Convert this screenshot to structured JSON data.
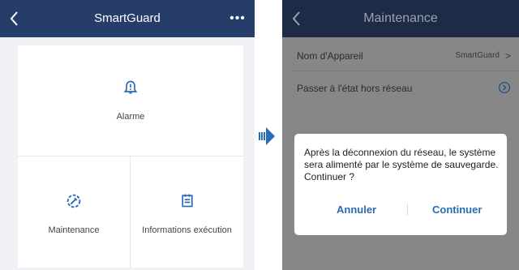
{
  "colors": {
    "header": "#263c69",
    "accent": "#2a6bb7",
    "overlay": "#878787"
  },
  "left_screen": {
    "header": {
      "back_icon": "chevron-left-icon",
      "title": "SmartGuard",
      "more_icon": "more-dots-icon"
    },
    "tiles": [
      {
        "icon": "alarm-bell-icon",
        "label": "Alarme"
      },
      {
        "icon": "wrench-gear-icon",
        "label": "Maintenance"
      },
      {
        "icon": "clipboard-icon",
        "label": "Informations exécution"
      }
    ]
  },
  "transition_icon": "arrow-right-icon",
  "right_screen": {
    "header": {
      "back_icon": "chevron-left-icon",
      "title": "Maintenance"
    },
    "rows": [
      {
        "label": "Nom d'Appareil",
        "value": "SmartGuard",
        "chevron": ">"
      },
      {
        "label": "Passer à l'état hors réseau",
        "icon": "circle-arrow-icon"
      }
    ],
    "dialog": {
      "message": "Après la déconnexion du réseau, le système sera alimenté par le système de sauvegarde. Continuer ?",
      "cancel_label": "Annuler",
      "confirm_label": "Continuer"
    }
  }
}
